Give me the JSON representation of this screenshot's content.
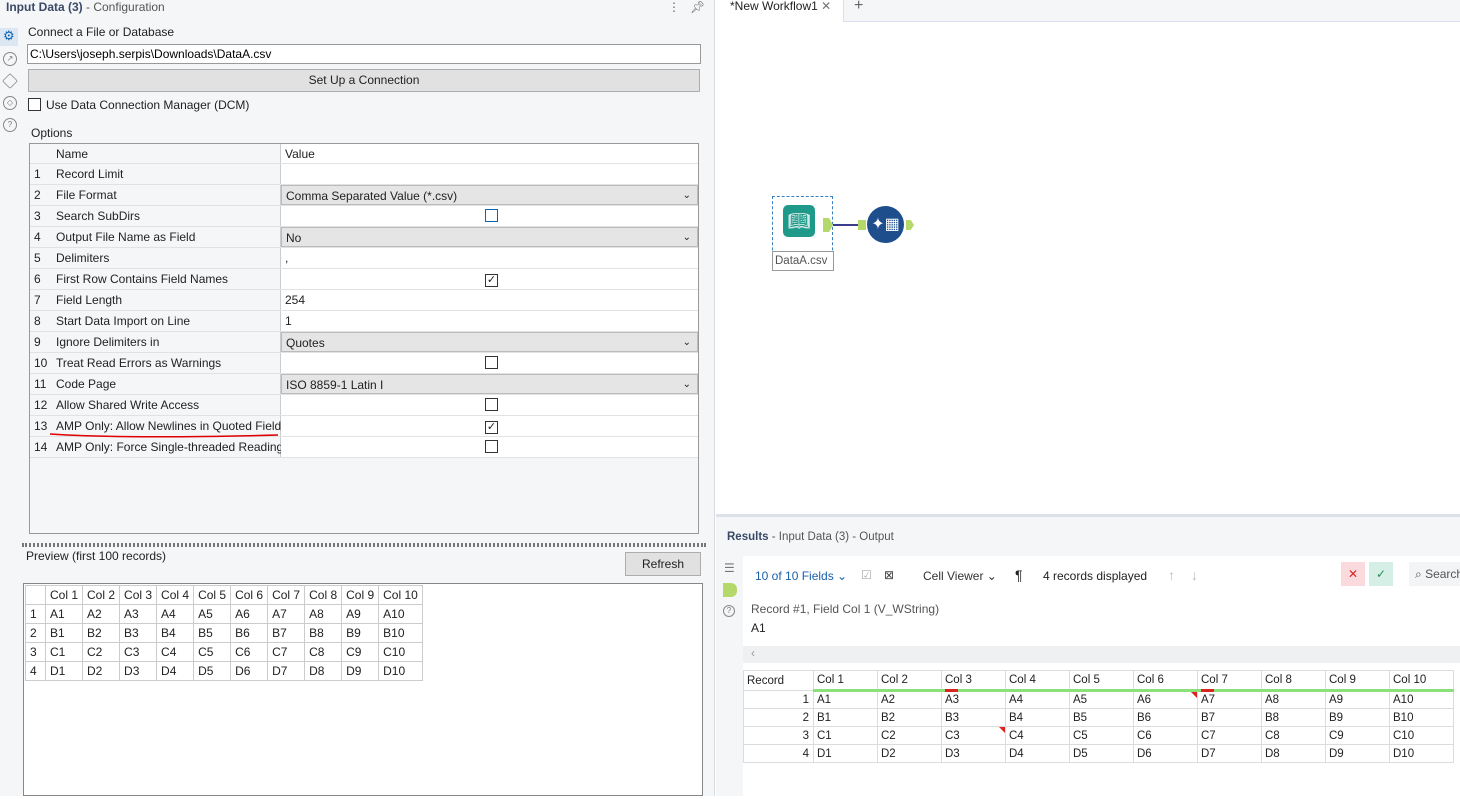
{
  "config": {
    "tool": "Input Data (3)",
    "subtitle": "- Configuration",
    "connect_label": "Connect a File or Database",
    "path": "C:\\Users\\joseph.serpis\\Downloads\\DataA.csv",
    "setup_button": "Set Up a Connection",
    "dcm_label": "Use Data Connection Manager (DCM)",
    "options_label": "Options",
    "col_name": "Name",
    "col_value": "Value",
    "options": [
      {
        "n": "1",
        "name": "Record Limit",
        "type": "text",
        "value": ""
      },
      {
        "n": "2",
        "name": "File Format",
        "type": "select",
        "value": "Comma Separated Value (*.csv)"
      },
      {
        "n": "3",
        "name": "Search SubDirs",
        "type": "check",
        "checked": false
      },
      {
        "n": "4",
        "name": "Output File Name as Field",
        "type": "select",
        "value": "No"
      },
      {
        "n": "5",
        "name": "Delimiters",
        "type": "text",
        "value": ","
      },
      {
        "n": "6",
        "name": "First Row Contains Field Names",
        "type": "check",
        "checked": true
      },
      {
        "n": "7",
        "name": "Field Length",
        "type": "text",
        "value": "254"
      },
      {
        "n": "8",
        "name": "Start Data Import on Line",
        "type": "text",
        "value": "1"
      },
      {
        "n": "9",
        "name": "Ignore Delimiters in",
        "type": "select",
        "value": "Quotes"
      },
      {
        "n": "10",
        "name": "Treat Read Errors as Warnings",
        "type": "check",
        "checked": false
      },
      {
        "n": "11",
        "name": "Code Page",
        "type": "select",
        "value": "ISO 8859-1 Latin I"
      },
      {
        "n": "12",
        "name": "Allow Shared Write Access",
        "type": "check",
        "checked": false
      },
      {
        "n": "13",
        "name": "AMP Only: Allow Newlines in Quoted Fields",
        "type": "check",
        "checked": true
      },
      {
        "n": "14",
        "name": "AMP Only: Force Single-threaded Reading",
        "type": "check",
        "checked": false
      }
    ],
    "preview_label": "Preview (first 100 records)",
    "refresh_button": "Refresh"
  },
  "columns": [
    "Col 1",
    "Col 2",
    "Col 3",
    "Col 4",
    "Col 5",
    "Col 6",
    "Col 7",
    "Col 8",
    "Col 9",
    "Col 10"
  ],
  "rows": [
    [
      "A1",
      "A2",
      "A3",
      "A4",
      "A5",
      "A6",
      "A7",
      "A8",
      "A9",
      "A10"
    ],
    [
      "B1",
      "B2",
      "B3",
      "B4",
      "B5",
      "B6",
      "B7",
      "B8",
      "B9",
      "B10"
    ],
    [
      "C1",
      "C2",
      "C3",
      "C4",
      "C5",
      "C6",
      "C7",
      "C8",
      "C9",
      "C10"
    ],
    [
      "D1",
      "D2",
      "D3",
      "D4",
      "D5",
      "D6",
      "D7",
      "D8",
      "D9",
      "D10"
    ]
  ],
  "workflow": {
    "tab": "*New Workflow1",
    "node_label": "DataA.csv"
  },
  "results": {
    "title": "Results",
    "subtitle": "- Input Data (3) - Output",
    "fields": "10 of 10 Fields",
    "viewer": "Cell Viewer",
    "count": "4 records displayed",
    "search": "Search",
    "cell_info": "Record #1, Field Col 1 (V_WString)",
    "cell_value": "A1",
    "record_header": "Record"
  },
  "colors": {
    "accent": "#0a64b4",
    "good": "#8be07a",
    "bad": "#dd2222"
  }
}
